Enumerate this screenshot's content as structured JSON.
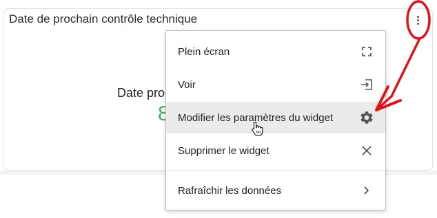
{
  "widget": {
    "title": "Date de prochain contrôle technique",
    "body_label": "Date pro",
    "body_value": "8"
  },
  "menu": {
    "items": [
      {
        "label": "Plein écran",
        "icon": "fullscreen-icon"
      },
      {
        "label": "Voir",
        "icon": "open-icon"
      },
      {
        "label": "Modifier les paramètres du widget",
        "icon": "gear-icon"
      },
      {
        "label": "Supprimer le widget",
        "icon": "close-icon"
      },
      {
        "label": "Rafraîchir les données",
        "icon": "chevron-right-icon"
      }
    ]
  },
  "colors": {
    "annotation": "#e0121a",
    "value_green": "#3aaa6e",
    "hover_bg": "#ebebeb"
  }
}
